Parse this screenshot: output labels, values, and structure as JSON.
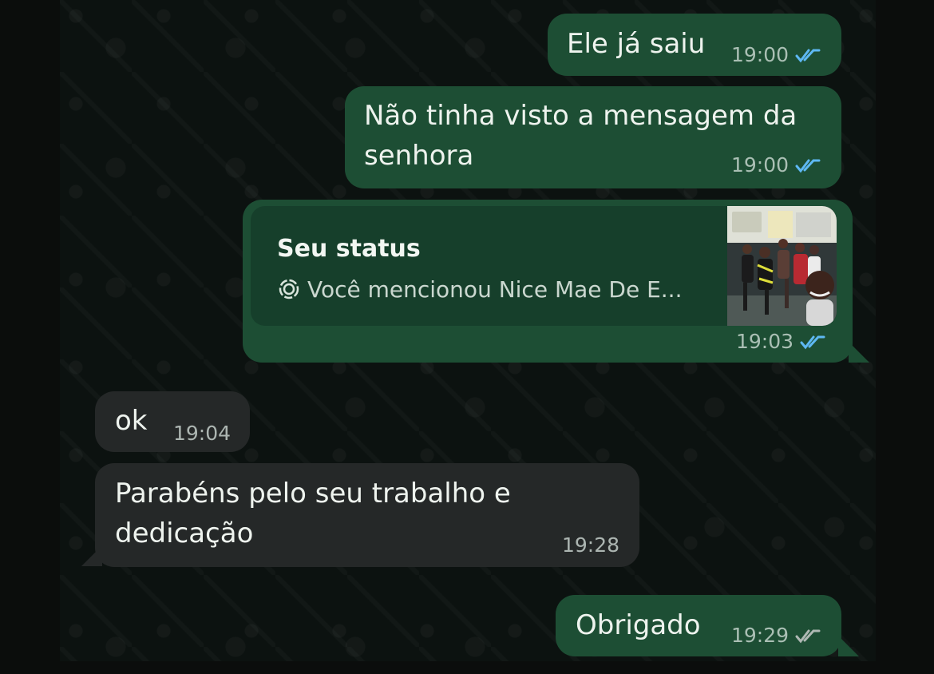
{
  "messages": [
    {
      "direction": "out",
      "text": "Ele já saiu",
      "time": "19:00",
      "status_icon": "read-double-check-icon"
    },
    {
      "direction": "out",
      "text_lines": [
        "Não tinha visto a mensagem da",
        "senhora"
      ],
      "time": "19:00",
      "status_icon": "read-double-check-icon"
    },
    {
      "direction": "out",
      "kind": "status-reply",
      "status_title": "Seu status",
      "status_description": "Você mencionou Nice Mae De E...",
      "status_icon": "status-ring-icon",
      "time": "19:03",
      "read_icon": "read-double-check-icon"
    },
    {
      "direction": "in",
      "text": "ok",
      "time": "19:04"
    },
    {
      "direction": "in",
      "text_lines": [
        "Parabéns pelo seu trabalho e",
        "dedicação"
      ],
      "time": "19:28"
    },
    {
      "direction": "out",
      "text": "Obrigado",
      "time": "19:29",
      "status_icon": "delivered-double-check-icon"
    }
  ],
  "colors": {
    "outgoing_bubble": "#1d4e34",
    "incoming_bubble": "#252828",
    "read_check": "#5eb8f3",
    "delivered_check": "#aeb8b3",
    "chat_background": "#0c1210"
  }
}
